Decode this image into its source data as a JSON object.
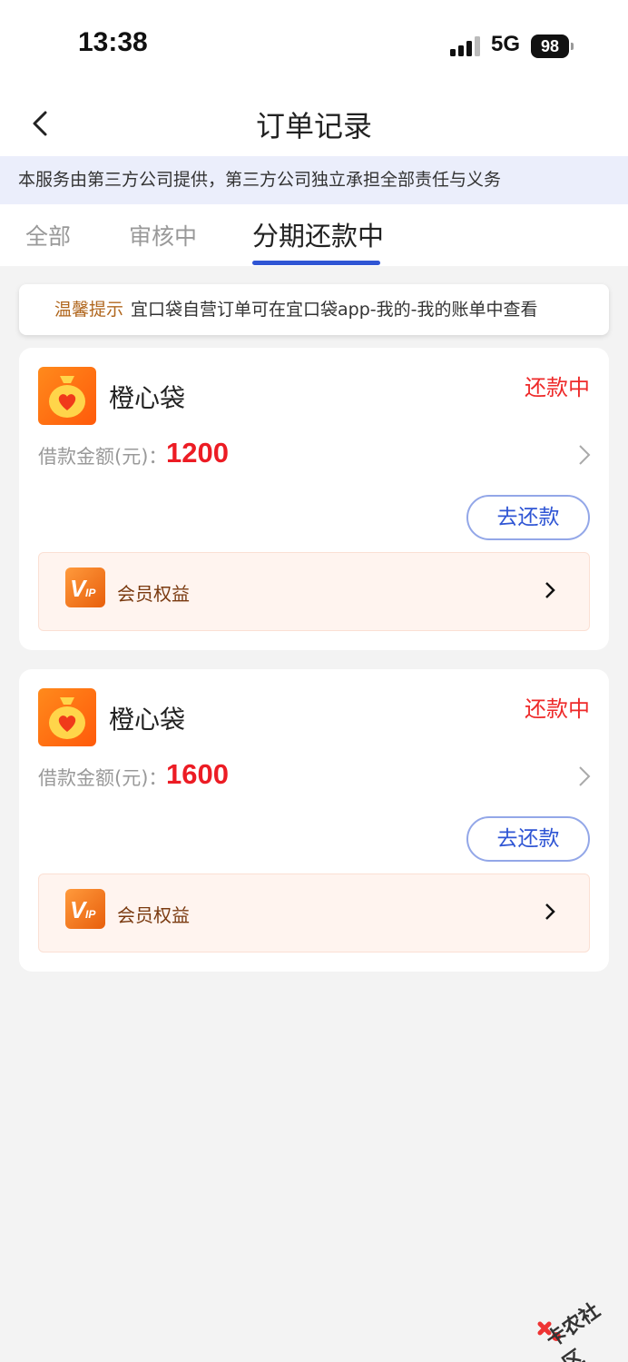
{
  "status_bar": {
    "time": "13:38",
    "network": "5G",
    "battery": "98"
  },
  "header": {
    "title": "订单记录"
  },
  "notice": "本服务由第三方公司提供，第三方公司独立承担全部责任与义务",
  "tabs": [
    {
      "label": "全部",
      "active": false
    },
    {
      "label": "审核中",
      "active": false
    },
    {
      "label": "分期还款中",
      "active": true
    }
  ],
  "tip": {
    "label": "温馨提示",
    "text": "宜口袋自营订单可在宜口袋app-我的-我的账单中查看"
  },
  "orders": [
    {
      "app_name": "橙心袋",
      "status": "还款中",
      "amount_label": "借款金额(元)：",
      "amount": "1200",
      "repay_button": "去还款",
      "member_label": "会员权益"
    },
    {
      "app_name": "橙心袋",
      "status": "还款中",
      "amount_label": "借款金额(元)：",
      "amount": "1600",
      "repay_button": "去还款",
      "member_label": "会员权益"
    }
  ],
  "watermark": "卡农社区",
  "colors": {
    "accent_blue": "#2f55d4",
    "status_red": "#ee2a2a",
    "amount_red": "#ec1c24",
    "brand_orange": "#ff6a10"
  }
}
